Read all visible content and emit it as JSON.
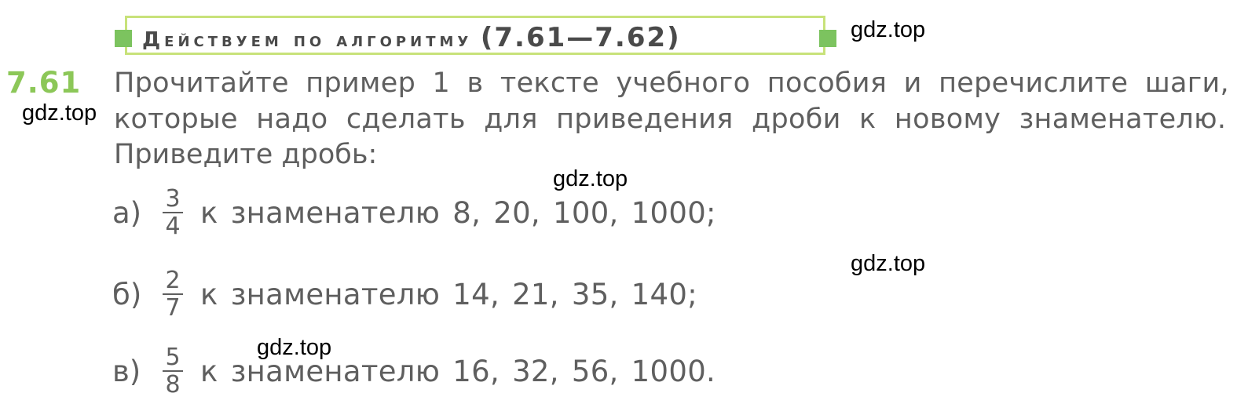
{
  "header": {
    "title": "Действуем по алгоритму",
    "range": "(7.61—7.62)",
    "accent_color": "#8cc758",
    "border_color": "#c8e27a"
  },
  "task": {
    "number": "7.61",
    "lines": [
      "Прочитайте пример 1 в тексте учебного пособия и перечислите шаги,",
      "которые надо сделать для приведения дроби к новому знаменателю.",
      "Приведите дробь:"
    ],
    "items": [
      {
        "label": "а)",
        "numerator": "3",
        "denominator": "4",
        "text": "к знаменателю 8, 20, 100, 1000;"
      },
      {
        "label": "б)",
        "numerator": "2",
        "denominator": "7",
        "text": "к знаменателю 14, 21, 35, 140;"
      },
      {
        "label": "в)",
        "numerator": "5",
        "denominator": "8",
        "text": "к знаменателю 16, 32, 56, 1000."
      }
    ]
  },
  "watermarks": [
    "gdz.top",
    "gdz.top",
    "gdz.top",
    "gdz.top",
    "gdz.top"
  ]
}
